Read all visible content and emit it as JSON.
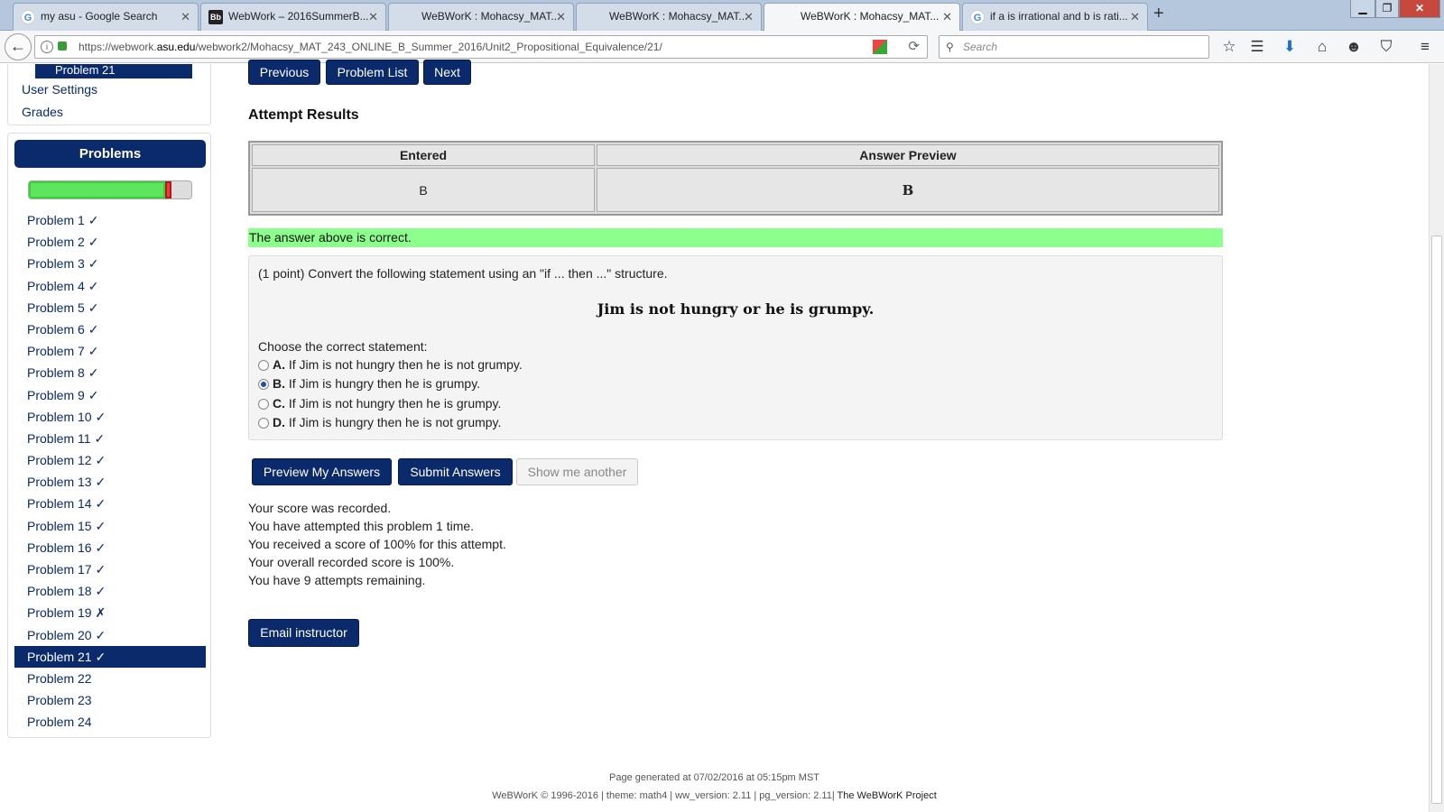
{
  "browser": {
    "tabs": [
      {
        "title": "my asu - Google Search",
        "favicon": "google-icon"
      },
      {
        "title": "WebWork – 2016SummerB...",
        "favicon": "blackboard-icon"
      },
      {
        "title": "WeBWorK : Mohacsy_MAT...",
        "favicon": "none"
      },
      {
        "title": "WeBWorK : Mohacsy_MAT...",
        "favicon": "none"
      },
      {
        "title": "WeBWorK : Mohacsy_MAT...",
        "favicon": "none",
        "active": true
      },
      {
        "title": "if a is irrational and b is rati...",
        "favicon": "google-icon"
      }
    ],
    "url_prefix": "https://webwork.",
    "url_host": "asu.edu",
    "url_path": "/webwork2/Mohacsy_MAT_243_ONLINE_B_Summer_2016/Unit2_Propositional_Equivalence/21/",
    "search_placeholder": "Search"
  },
  "sidebar": {
    "current_item": "Problem 21",
    "links": [
      "User Settings",
      "Grades"
    ],
    "problems_heading": "Problems",
    "progress": {
      "correct_fraction": 0.84,
      "incorrect_fraction": 0.04
    },
    "problems": [
      "Problem 1 ✓",
      "Problem 2 ✓",
      "Problem 3 ✓",
      "Problem 4 ✓",
      "Problem 5 ✓",
      "Problem 6 ✓",
      "Problem 7 ✓",
      "Problem 8 ✓",
      "Problem 9 ✓",
      "Problem 10 ✓",
      "Problem 11 ✓",
      "Problem 12 ✓",
      "Problem 13 ✓",
      "Problem 14 ✓",
      "Problem 15 ✓",
      "Problem 16 ✓",
      "Problem 17 ✓",
      "Problem 18 ✓",
      "Problem 19 ✗",
      "Problem 20 ✓",
      "Problem 21 ✓",
      "Problem 22",
      "Problem 23",
      "Problem 24"
    ],
    "active_problem": "Problem 21 ✓"
  },
  "nav": {
    "previous": "Previous",
    "problem_list": "Problem List",
    "next": "Next"
  },
  "results": {
    "heading": "Attempt Results",
    "col_entered": "Entered",
    "col_preview": "Answer Preview",
    "entered": "B",
    "preview": "B",
    "message": "The answer above is correct."
  },
  "problem": {
    "intro": "(1 point) Convert the following statement using an \"if ... then ...\" structure.",
    "statement": "Jim is not hungry or he is grumpy.",
    "choose_label": "Choose the correct statement:",
    "options": [
      {
        "letter": "A.",
        "text": " If Jim is not hungry then he is not grumpy."
      },
      {
        "letter": "B.",
        "text": " If Jim is hungry then he is grumpy.",
        "selected": true
      },
      {
        "letter": "C.",
        "text": " If Jim is not hungry then he is grumpy."
      },
      {
        "letter": "D.",
        "text": " If Jim is hungry then he is not grumpy."
      }
    ]
  },
  "actions": {
    "preview": "Preview My Answers",
    "submit": "Submit Answers",
    "show_another": "Show me another"
  },
  "score_lines": [
    "Your score was recorded.",
    "You have attempted this problem 1 time.",
    "You received a score of 100% for this attempt.",
    "Your overall recorded score is 100%.",
    "You have 9 attempts remaining."
  ],
  "email_instructor": "Email instructor",
  "footer": {
    "generated": "Page generated at 07/02/2016 at 05:15pm MST",
    "credits": "WeBWorK © 1996-2016 | theme: math4 | ww_version: 2.11 | pg_version: 2.11|",
    "project_link": "The WeBWorK Project"
  },
  "colors": {
    "accent": "#0b2a6c",
    "correct": "#8cff8c",
    "progress_correct": "#5ee55e",
    "progress_wrong": "#ee3b3b"
  }
}
